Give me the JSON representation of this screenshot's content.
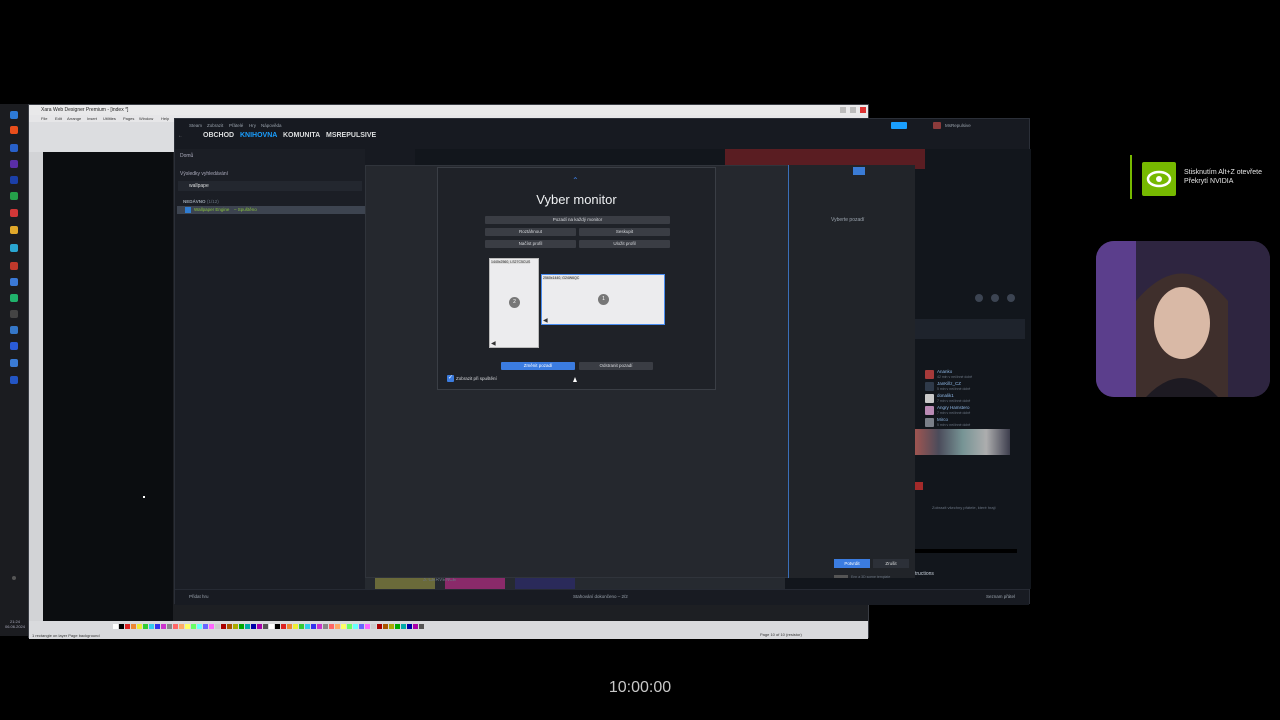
{
  "xara": {
    "title": "Xara Web Designer Premium - [index *]",
    "menu": [
      "File",
      "Edit",
      "Arrange",
      "Insert",
      "Utilities",
      "Pages",
      "Window",
      "Help"
    ],
    "status_text": "1 rectangle on layer Page background",
    "page_info": "Page 10 of 10 (resistor)"
  },
  "taskbar": {
    "time": "21:24",
    "date": "06.06.2024"
  },
  "steam": {
    "menu": [
      "Steam",
      "Zobrazit",
      "Přátelé",
      "Hry",
      "Nápověda"
    ],
    "nav": [
      "OBCHOD",
      "KNIHOVNA",
      "KOMUNITA",
      "MSREPULSIVE"
    ],
    "active_nav": "KNIHOVNA",
    "user": "MsRepulsive",
    "home_label": "Domů",
    "search_results_label": "Výsledky vyhledávání",
    "search_value": "wallpape",
    "recent_header": "NEDÁVNO",
    "recent_count": "(1/12)",
    "selected_game": "Wallpaper Engine",
    "selected_game_status": " – Spuštěno",
    "add_game": "Přidat hru",
    "downloads": "Stahování dokončeno – 2/2",
    "friends_chat": "Seznam přátel",
    "date_header": "3. ČERVENCE",
    "instructions": "tructions",
    "screenshot_hint": "Zobrazit všechny přátele, které hrají",
    "friends": [
      {
        "name": "Ananko",
        "status": "42 min v nečinné době"
      },
      {
        "name": "JanKillz_CZ",
        "status": "5 min v nečinné době"
      },
      {
        "name": "donalik1",
        "status": "7 min v nečinné době"
      },
      {
        "name": "Angry Hamstero",
        "status": "7 min v nečinné době"
      },
      {
        "name": "Mirco",
        "status": "5 min v nečinné době"
      }
    ]
  },
  "wallpaper_engine": {
    "right_panel_label": "Vyberte pozadí",
    "confirm_label": "Potvrdit",
    "cancel_label": "Zrušit",
    "info_text": "Enn a 3D scene template"
  },
  "modal": {
    "title": "Vyber monitor",
    "dropdown": "Pozadí na každý monitor",
    "btn_stretch": "Roztáhnout",
    "btn_group": "Seskupit",
    "btn_load_profile": "Načíst profil",
    "btn_save_profile": "Uložit profil",
    "monitor2_label": "1440x2560, LS27C5CUS",
    "monitor1_label": "2560x1440, G24W6QC",
    "monitor2_num": "2",
    "monitor1_num": "1",
    "btn_change": "Změnit pozadí",
    "btn_remove": "Odstranit pozadí",
    "checkbox_label": "Zobrazit při spuštění",
    "checkbox_checked": true
  },
  "nvidia": {
    "text": "Stisknutím Alt+Z otevřete Překrytí NVIDIA",
    "brand_color": "#76b900"
  },
  "timecode": "10:00:00"
}
